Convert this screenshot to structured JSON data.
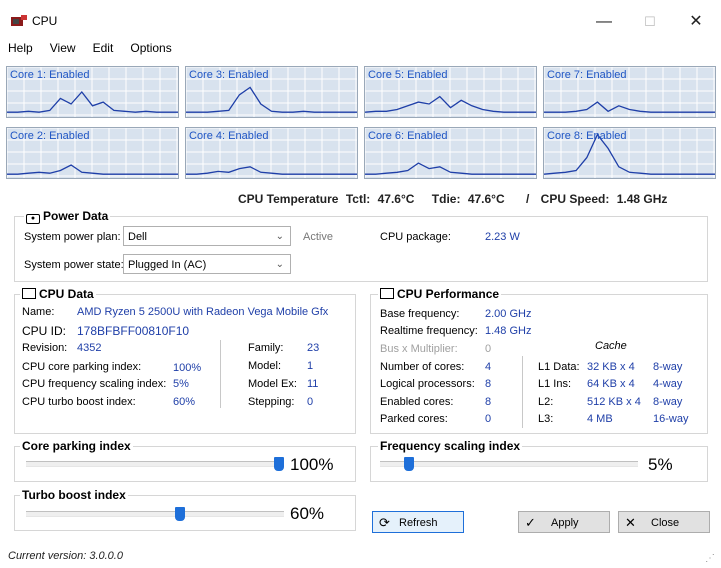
{
  "window": {
    "title": "CPU",
    "minimize": "—",
    "maximize": "☐",
    "close": "✕"
  },
  "menu": [
    "Help",
    "View",
    "Edit",
    "Options"
  ],
  "cores": [
    {
      "label": "Core 1: Enabled",
      "series": [
        3,
        3,
        4,
        3,
        5,
        18,
        12,
        25,
        10,
        14,
        5,
        4,
        3,
        4,
        3,
        3,
        3
      ]
    },
    {
      "label": "Core 3: Enabled",
      "series": [
        3,
        3,
        3,
        4,
        5,
        22,
        30,
        12,
        4,
        3,
        3,
        4,
        3,
        3,
        3,
        3,
        3
      ]
    },
    {
      "label": "Core 5: Enabled",
      "series": [
        3,
        4,
        4,
        6,
        10,
        14,
        12,
        20,
        8,
        16,
        10,
        6,
        4,
        3,
        3,
        3,
        3
      ]
    },
    {
      "label": "Core 7: Enabled",
      "series": [
        3,
        3,
        3,
        4,
        6,
        14,
        4,
        10,
        6,
        4,
        3,
        3,
        3,
        3,
        3,
        3,
        3
      ]
    },
    {
      "label": "Core 2: Enabled",
      "series": [
        2,
        2,
        3,
        4,
        3,
        6,
        12,
        4,
        3,
        2,
        2,
        2,
        2,
        2,
        2,
        2,
        2
      ]
    },
    {
      "label": "Core 4: Enabled",
      "series": [
        2,
        2,
        3,
        5,
        4,
        8,
        10,
        4,
        3,
        2,
        2,
        2,
        2,
        2,
        2,
        2,
        2
      ]
    },
    {
      "label": "Core 6: Enabled",
      "series": [
        2,
        2,
        3,
        4,
        6,
        14,
        8,
        10,
        4,
        3,
        2,
        2,
        2,
        2,
        2,
        2,
        2
      ]
    },
    {
      "label": "Core 8: Enabled",
      "series": [
        2,
        3,
        4,
        6,
        20,
        45,
        30,
        10,
        4,
        3,
        2,
        2,
        2,
        2,
        2,
        2,
        2
      ]
    }
  ],
  "status": {
    "temp_label": "CPU Temperature",
    "tctl_label": "Tctl:",
    "tctl": "47.6°C",
    "tdie_label": "Tdie:",
    "tdie": "47.6°C",
    "sep": "/",
    "speed_label": "CPU Speed:",
    "speed": "1.48 GHz"
  },
  "power": {
    "title": "Power Data",
    "plan_label": "System power plan:",
    "plan_value": "Dell",
    "plan_state": "Active",
    "state_label": "System power state:",
    "state_value": "Plugged In (AC)",
    "package_label": "CPU package:",
    "package_value": "2.23 W"
  },
  "cpu_data": {
    "title": "CPU Data",
    "name_label": "Name:",
    "name": "AMD Ryzen 5 2500U with Radeon Vega Mobile Gfx",
    "id_label": "CPU ID:",
    "id": "178BFBFF00810F10",
    "rev_label": "Revision:",
    "rev": "4352",
    "parking_label": "CPU core parking index:",
    "parking": "100%",
    "scaling_label": "CPU frequency scaling index:",
    "scaling": "5%",
    "turbo_label": "CPU turbo boost index:",
    "turbo": "60%",
    "family_label": "Family:",
    "family": "23",
    "model_label": "Model:",
    "model": "1",
    "modelex_label": "Model Ex:",
    "modelex": "11",
    "stepping_label": "Stepping:",
    "stepping": "0"
  },
  "cpu_perf": {
    "title": "CPU Performance",
    "base_label": "Base frequency:",
    "base": "2.00 GHz",
    "real_label": "Realtime frequency:",
    "real": "1.48 GHz",
    "mult_label": "Bus x Multiplier:",
    "mult": "0",
    "cores_label": "Number of cores:",
    "cores": "4",
    "logical_label": "Logical processors:",
    "logical": "8",
    "enabled_label": "Enabled cores:",
    "enabled": "8",
    "parked_label": "Parked cores:",
    "parked": "0",
    "cache_title": "Cache",
    "l1d_label": "L1 Data:",
    "l1d": "32 KB x 4",
    "l1d_way": "8-way",
    "l1i_label": "L1 Ins:",
    "l1i": "64 KB x 4",
    "l1i_way": "4-way",
    "l2_label": "L2:",
    "l2": "512 KB x 4",
    "l2_way": "8-way",
    "l3_label": "L3:",
    "l3": "4 MB",
    "l3_way": "16-way"
  },
  "sliders": {
    "parking": {
      "title": "Core parking index",
      "value_text": "100%",
      "value": 1.0
    },
    "scaling": {
      "title": "Frequency scaling index",
      "value_text": "5%",
      "value": 0.05
    },
    "turbo": {
      "title": "Turbo boost index",
      "value_text": "60%",
      "value": 0.6
    }
  },
  "buttons": {
    "refresh": "Refresh",
    "apply": "Apply",
    "close": "Close"
  },
  "footer": {
    "version_label": "Current version:",
    "version": "3.0.0.0"
  }
}
